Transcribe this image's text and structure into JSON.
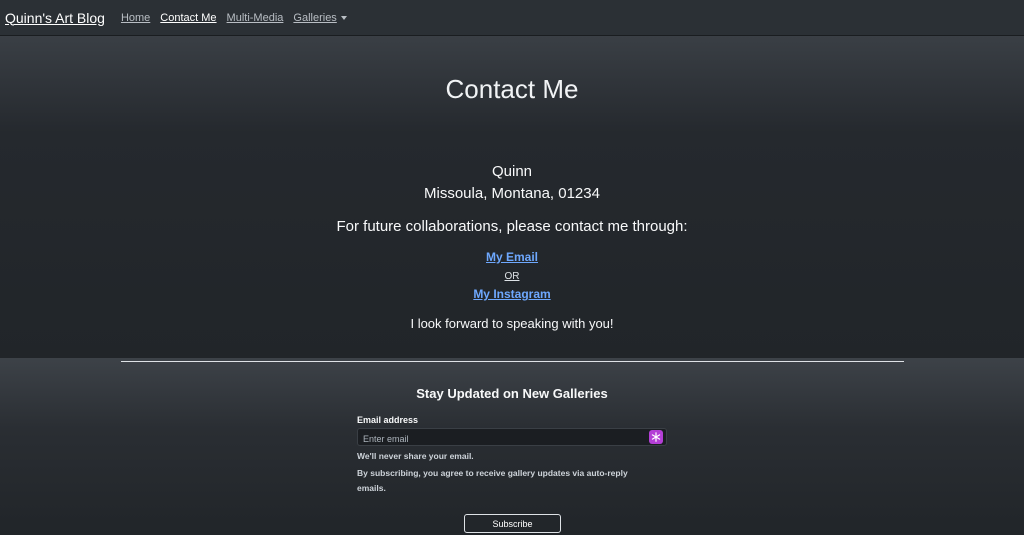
{
  "nav": {
    "brand": "Quinn's Art Blog",
    "items": [
      {
        "label": "Home"
      },
      {
        "label": "Contact Me"
      },
      {
        "label": "Multi-Media"
      },
      {
        "label": "Galleries"
      }
    ]
  },
  "hero": {
    "title": "Contact Me",
    "name": "Quinn",
    "location": "Missoula, Montana, 01234",
    "intro": "For future collaborations, please contact me through:",
    "email_link": "My Email",
    "or": "OR",
    "instagram_link": "My Instagram",
    "closing": "I look forward to speaking with you!"
  },
  "subscribe": {
    "title": "Stay Updated on New Galleries",
    "email_label": "Email address",
    "email_placeholder": "Enter email",
    "email_value": "",
    "help_line1": "We'll never share your email.",
    "help_line2": "By subscribing, you agree to receive gallery updates via auto-reply emails.",
    "button": "Subscribe"
  },
  "colors": {
    "link": "#6ea8fe",
    "extension_icon": "#b43fd6",
    "background": "#212529"
  }
}
